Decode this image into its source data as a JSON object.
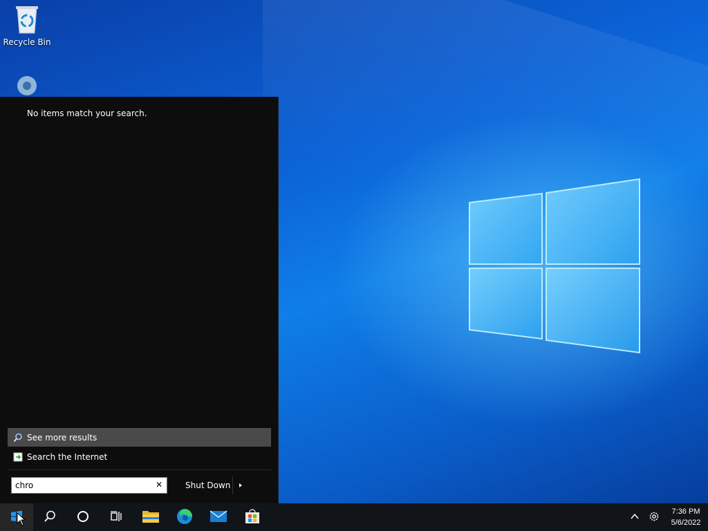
{
  "desktop": {
    "icons": [
      {
        "label": "Recycle Bin",
        "icon": "recycle-bin-icon"
      },
      {
        "label": "",
        "icon": "settings-gear-icon"
      }
    ]
  },
  "start_menu": {
    "empty_message": "No items match your search.",
    "results": [
      {
        "label": "See more results",
        "icon": "magnifier-icon",
        "selected": true
      },
      {
        "label": "Search the Internet",
        "icon": "internet-search-icon",
        "selected": false
      }
    ],
    "search": {
      "value": "chro",
      "clear_icon": "clear-x-icon"
    },
    "shutdown": {
      "label": "Shut Down",
      "arrow_icon": "chevron-right-icon"
    }
  },
  "taskbar": {
    "buttons": [
      {
        "name": "start",
        "icon": "windows-start-icon"
      },
      {
        "name": "search",
        "icon": "search-icon"
      },
      {
        "name": "cortana",
        "icon": "cortana-circle-icon"
      },
      {
        "name": "task-view",
        "icon": "task-view-icon"
      },
      {
        "name": "file-explorer",
        "icon": "folder-icon"
      },
      {
        "name": "edge",
        "icon": "edge-browser-icon"
      },
      {
        "name": "mail",
        "icon": "mail-icon"
      },
      {
        "name": "store",
        "icon": "store-icon"
      }
    ],
    "tray": {
      "overflow_icon": "chevron-up-icon",
      "settings_icon": "gear-icon",
      "time": "7:36 PM",
      "date": "5/6/2022"
    }
  },
  "colors": {
    "menu_bg": "#0d0d0d",
    "selected_row": "#4a4a4a",
    "taskbar_bg": "#111418",
    "accent": "#0078d7"
  }
}
